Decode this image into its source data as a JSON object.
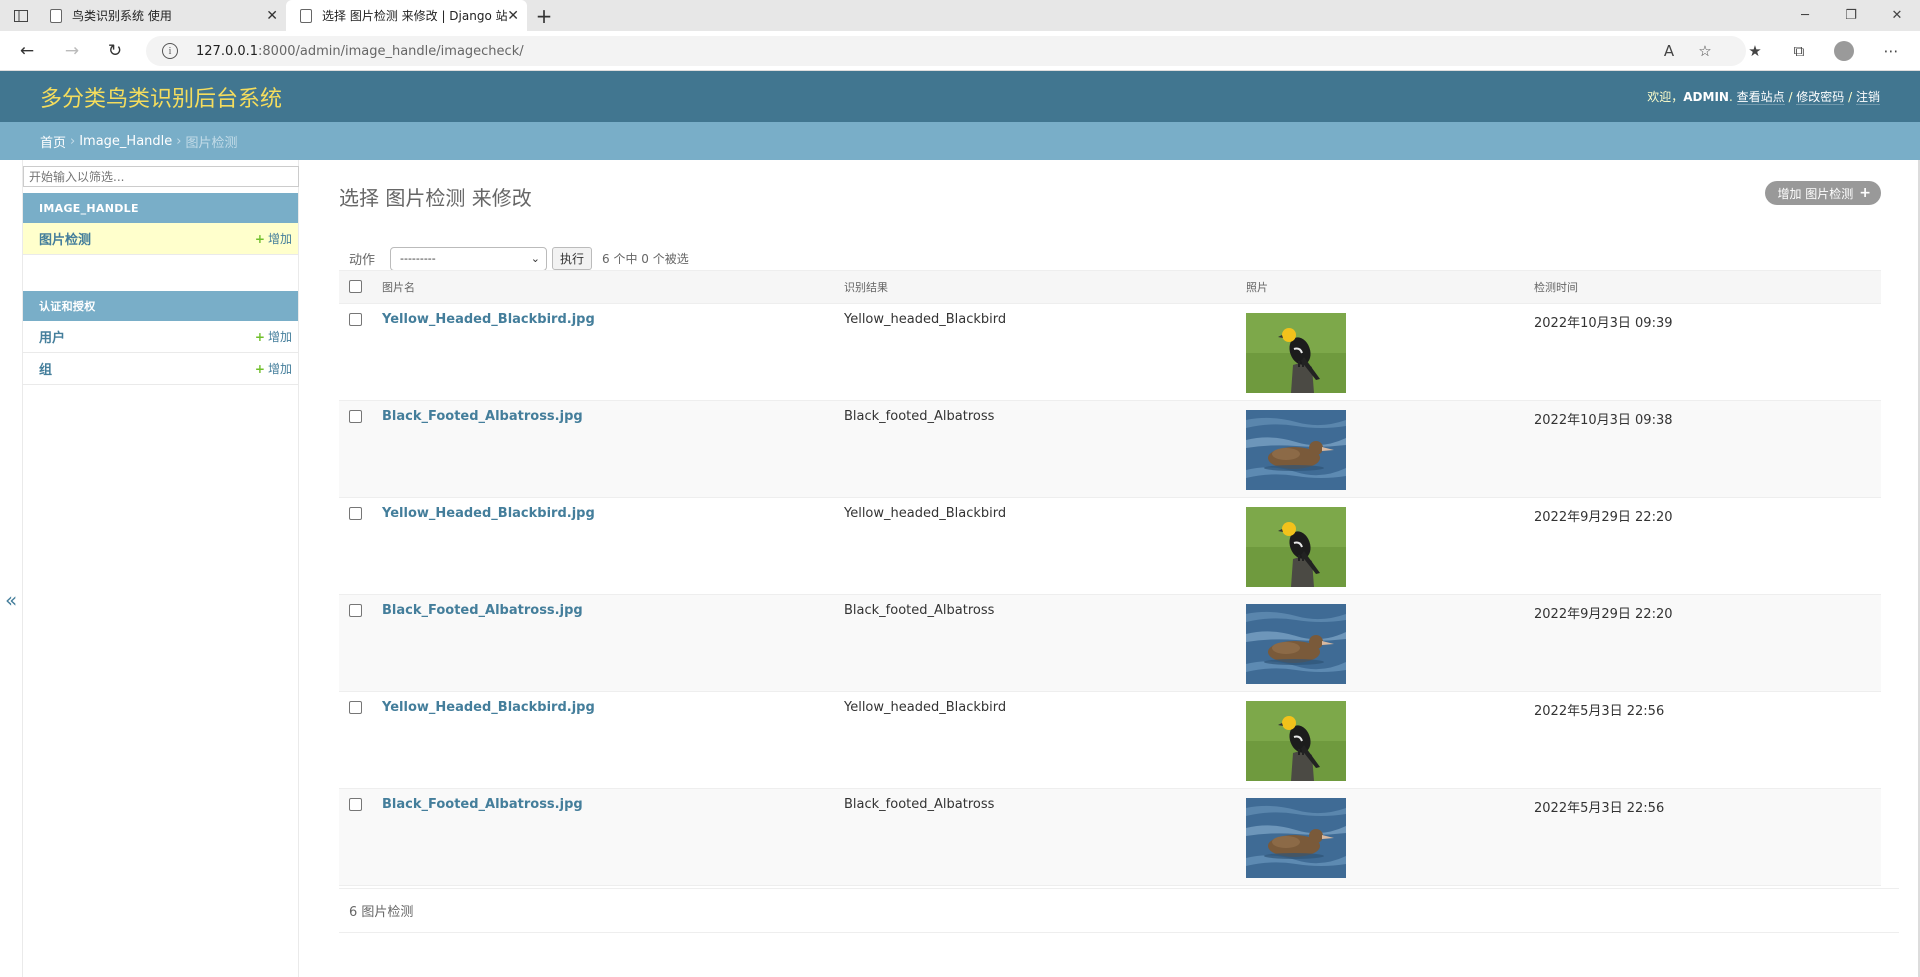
{
  "browser": {
    "tabs": [
      {
        "title": "鸟类识别系统 使用",
        "active": false
      },
      {
        "title": "选择 图片检测 来修改 | Django 站",
        "active": true
      }
    ],
    "url_host": "127.0.0.1",
    "url_rest": ":8000/admin/image_handle/imagecheck/"
  },
  "header": {
    "branding": "多分类鸟类识别后台系统",
    "welcome": "欢迎，",
    "username": "ADMIN",
    "view_site": "查看站点",
    "change_password": "修改密码",
    "logout": "注销",
    "slash": " / "
  },
  "breadcrumbs": {
    "home": "首页",
    "app": "Image_Handle",
    "current": "图片检测",
    "sep": "›"
  },
  "sidebar": {
    "filter_placeholder": "开始输入以筛选...",
    "apps": [
      {
        "caption": "IMAGE_HANDLE",
        "models": [
          {
            "name": "图片检测",
            "add": "增加",
            "current": true
          }
        ]
      },
      {
        "caption": "认证和授权",
        "models": [
          {
            "name": "用户",
            "add": "增加"
          },
          {
            "name": "组",
            "add": "增加"
          }
        ]
      }
    ],
    "collapse": "«"
  },
  "content": {
    "title": "选择 图片检测 来修改",
    "add_button": "增加 图片检测",
    "actions_label": "动作",
    "action_select": "---------",
    "go_button": "执行",
    "selection_counter": "6 个中 0 个被选",
    "columns": [
      "图片名",
      "识别结果",
      "照片",
      "检测时间"
    ],
    "rows": [
      {
        "name": "Yellow_Headed_Blackbird.jpg",
        "result": "Yellow_headed_Blackbird",
        "photo": "blackbird-photo",
        "time": "2022年10月3日 09:39"
      },
      {
        "name": "Black_Footed_Albatross.jpg",
        "result": "Black_footed_Albatross",
        "photo": "albatross-photo",
        "time": "2022年10月3日 09:38"
      },
      {
        "name": "Yellow_Headed_Blackbird.jpg",
        "result": "Yellow_headed_Blackbird",
        "photo": "blackbird-photo",
        "time": "2022年9月29日 22:20"
      },
      {
        "name": "Black_Footed_Albatross.jpg",
        "result": "Black_footed_Albatross",
        "photo": "albatross-photo",
        "time": "2022年9月29日 22:20"
      },
      {
        "name": "Yellow_Headed_Blackbird.jpg",
        "result": "Yellow_headed_Blackbird",
        "photo": "blackbird-photo",
        "time": "2022年5月3日 22:56"
      },
      {
        "name": "Black_Footed_Albatross.jpg",
        "result": "Black_footed_Albatross",
        "photo": "albatross-photo",
        "time": "2022年5月3日 22:56"
      }
    ],
    "paginator": "6 图片检测"
  },
  "colors": {
    "header_bg": "#417690",
    "branding": "#f5dd5d",
    "breadcrumbs_bg": "#79aec8",
    "link": "#447e9b",
    "add_plus": "#70bf2b"
  }
}
